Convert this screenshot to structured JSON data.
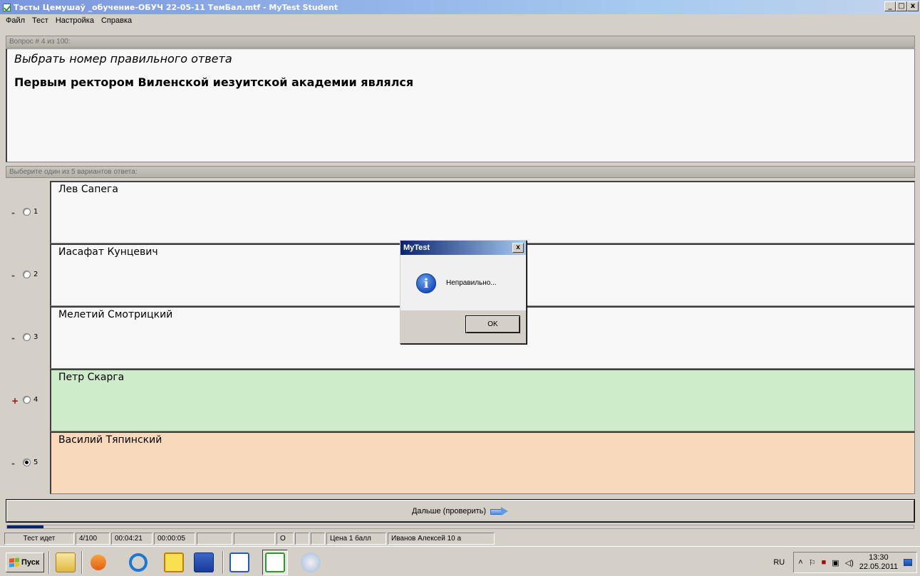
{
  "window": {
    "title": "Тэсты Цемушаў _обучение-ОБУЧ 22-05-11 ТемБал.mtf - MyTest Student",
    "buttons": [
      "_",
      "□",
      "x"
    ]
  },
  "menu": [
    "Файл",
    "Тест",
    "Настройка",
    "Справка"
  ],
  "question": {
    "header": "Вопрос # 4 из 100:",
    "instruction": "Выбрать номер правильного ответа",
    "text": "Первым ректором Виленской иезуитской академии являлся"
  },
  "answers_header": "Выберите один из 5 вариантов ответа:",
  "answers": [
    {
      "mark": "-",
      "number": "1",
      "text": "Лев Сапега",
      "state": "neutral",
      "selected": false
    },
    {
      "mark": "-",
      "number": "2",
      "text": "Иасафат Кунцевич",
      "state": "neutral",
      "selected": false
    },
    {
      "mark": "-",
      "number": "3",
      "text": "Мелетий Смотрицкий",
      "state": "neutral",
      "selected": false
    },
    {
      "mark": "+",
      "number": "4",
      "text": "Петр Скарга",
      "state": "correct",
      "selected": false
    },
    {
      "mark": "-",
      "number": "5",
      "text": "Василий Тяпинский",
      "state": "wrong",
      "selected": true
    }
  ],
  "next_button": {
    "label": "Дальше (проверить)"
  },
  "progress": {
    "fraction": 0.04
  },
  "status": {
    "state": "Тест идет",
    "question_count": "4/100",
    "elapsed": "00:04:21",
    "question_time": "00:00:05",
    "empty1": "",
    "empty2": "",
    "marker": "О",
    "empty3": "",
    "empty4": "",
    "price": "Цена 1 балл",
    "student": "Иванов Алексей 10 а"
  },
  "dialog": {
    "title": "MyTest",
    "close": "x",
    "message": "Неправильно...",
    "ok_label": "OK"
  },
  "taskbar": {
    "start_label": "Пуск",
    "lang": "RU",
    "time": "13:30",
    "date": "22.05.2011"
  },
  "colors": {
    "correct_bg": "#ceecca",
    "wrong_bg": "#f9d9bb",
    "title_bar": "#0a246a"
  }
}
